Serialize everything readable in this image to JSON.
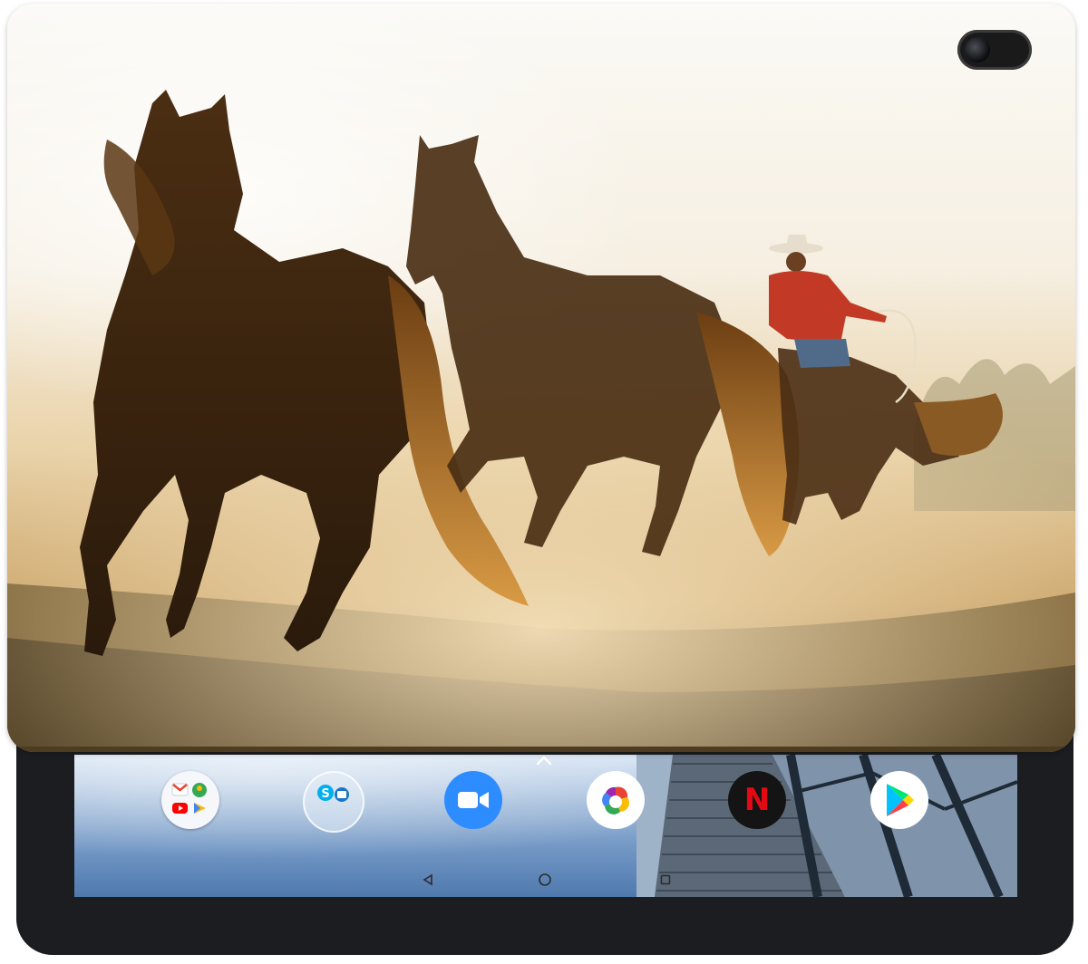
{
  "dock": {
    "apps": [
      {
        "id": "google-folder",
        "icon": "google-apps-folder-icon"
      },
      {
        "id": "skype-folder",
        "icon": "skype-folder-icon"
      },
      {
        "id": "zoom",
        "icon": "zoom-video-icon"
      },
      {
        "id": "photos",
        "icon": "colorful-photos-icon"
      },
      {
        "id": "netflix",
        "icon": "netflix-icon",
        "label": "N"
      },
      {
        "id": "play-store",
        "icon": "play-store-icon"
      }
    ],
    "up_chevron_icon": "chevron-up-icon"
  },
  "navbar": {
    "back_icon": "back-triangle-icon",
    "home_icon": "home-circle-icon",
    "recents_icon": "recents-square-icon"
  },
  "colors": {
    "zoom_blue": "#2D8CFF",
    "netflix_red": "#E50914",
    "tablet_frame": "#1c1d20"
  }
}
